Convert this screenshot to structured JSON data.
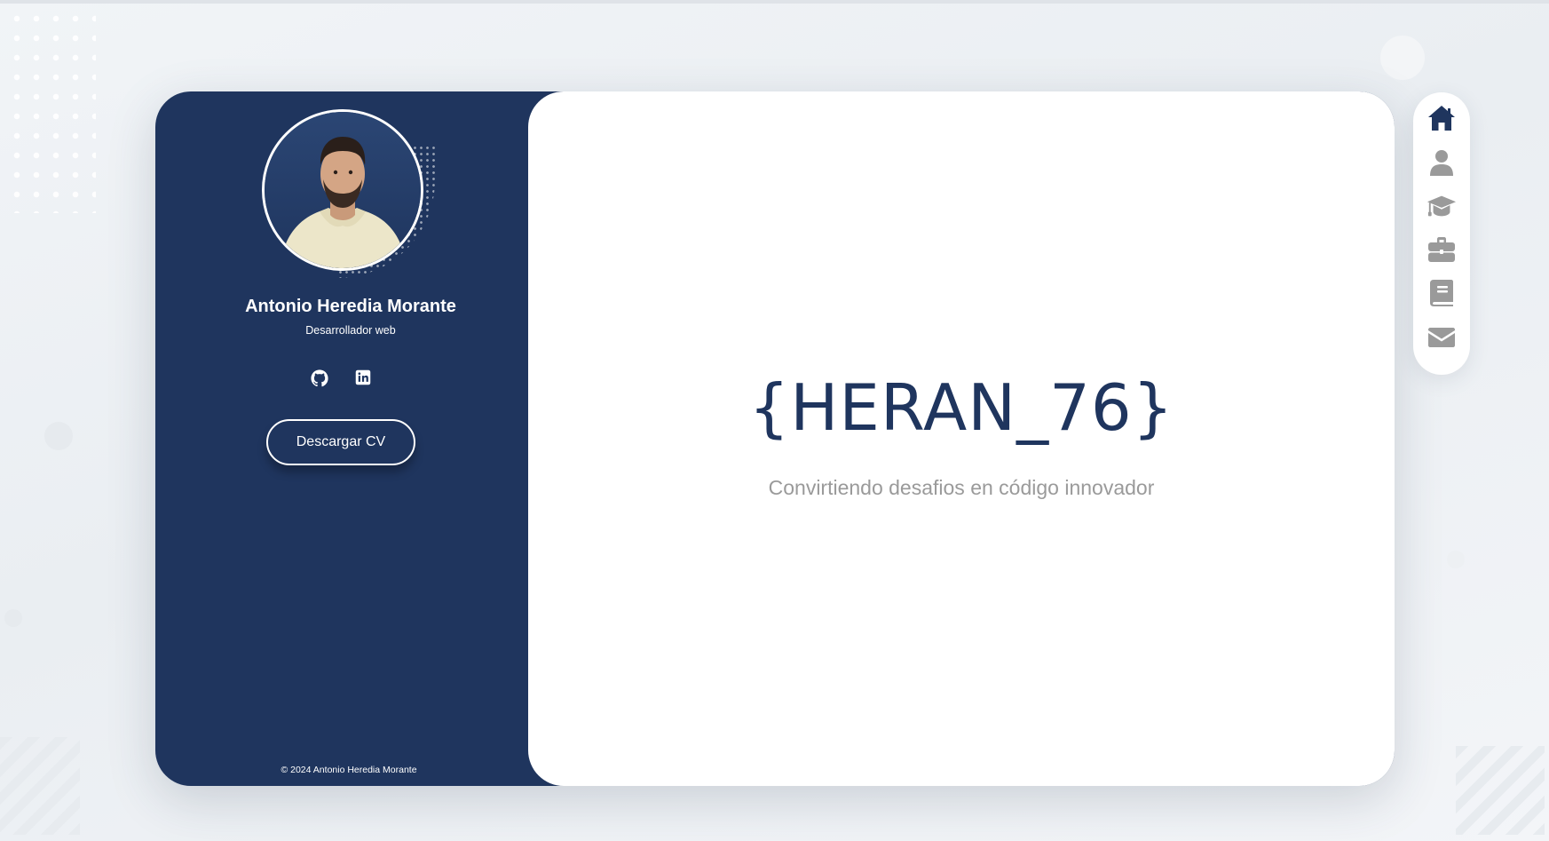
{
  "profile": {
    "name": "Antonio Heredia Morante",
    "role": "Desarrollador web",
    "cv_button": "Descargar CV",
    "footer": "© 2024 Antonio Heredia Morante"
  },
  "socials": [
    {
      "icon": "github-icon"
    },
    {
      "icon": "linkedin-icon"
    }
  ],
  "hero": {
    "title": "{HERAN_76}",
    "subtitle": "Convirtiendo desafios en código innovador"
  },
  "nav": {
    "items": [
      {
        "icon": "home-icon",
        "active": true
      },
      {
        "icon": "user-icon",
        "active": false
      },
      {
        "icon": "graduation-cap-icon",
        "active": false
      },
      {
        "icon": "briefcase-icon",
        "active": false
      },
      {
        "icon": "book-icon",
        "active": false
      },
      {
        "icon": "envelope-icon",
        "active": false
      }
    ]
  },
  "colors": {
    "primary": "#1f355e",
    "muted_icon": "#9a9a9a",
    "subtitle": "#9a9a9a",
    "background": "#eef1f4"
  }
}
